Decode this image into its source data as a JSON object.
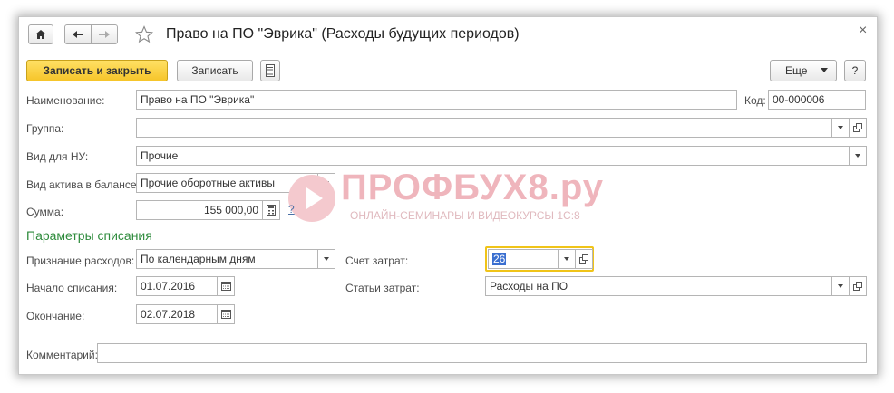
{
  "window": {
    "title": "Право на ПО \"Эврика\" (Расходы будущих периодов)",
    "close_glyph": "×"
  },
  "toolbar": {
    "save_close_label": "Записать и закрыть",
    "save_label": "Записать",
    "more_label": "Еще",
    "help_label": "?"
  },
  "form": {
    "name_label": "Наименование:",
    "name_value": "Право на ПО \"Эврика\"",
    "code_label": "Код:",
    "code_value": "00-000006",
    "group_label": "Группа:",
    "group_value": "",
    "nu_type_label": "Вид для НУ:",
    "nu_type_value": "Прочие",
    "asset_type_label": "Вид актива в балансе:",
    "asset_type_value": "Прочие оборотные активы",
    "sum_label": "Сумма:",
    "sum_value": "155 000,00",
    "sum_help": "?"
  },
  "writeoff": {
    "section_title": "Параметры списания",
    "recognition_label": "Признание расходов:",
    "recognition_value": "По календарным дням",
    "start_label": "Начало списания:",
    "start_value": "01.07.2016",
    "end_label": "Окончание:",
    "end_value": "02.07.2018",
    "cost_account_label": "Счет затрат:",
    "cost_account_value": "26",
    "cost_items_label": "Статьи затрат:",
    "cost_items_value": "Расходы на ПО"
  },
  "comment": {
    "label": "Комментарий:",
    "value": ""
  },
  "watermark": {
    "brand": "ПРОФБУХ8.ру",
    "tagline": "ОНЛАЙН-СЕМИНАРЫ И ВИДЕОКУРСЫ 1С:8"
  },
  "colors": {
    "primary_button": "#f6c52a",
    "section_title": "#2e8b3c",
    "focus_border": "#f0c419",
    "watermark": "#e8a0a8"
  }
}
